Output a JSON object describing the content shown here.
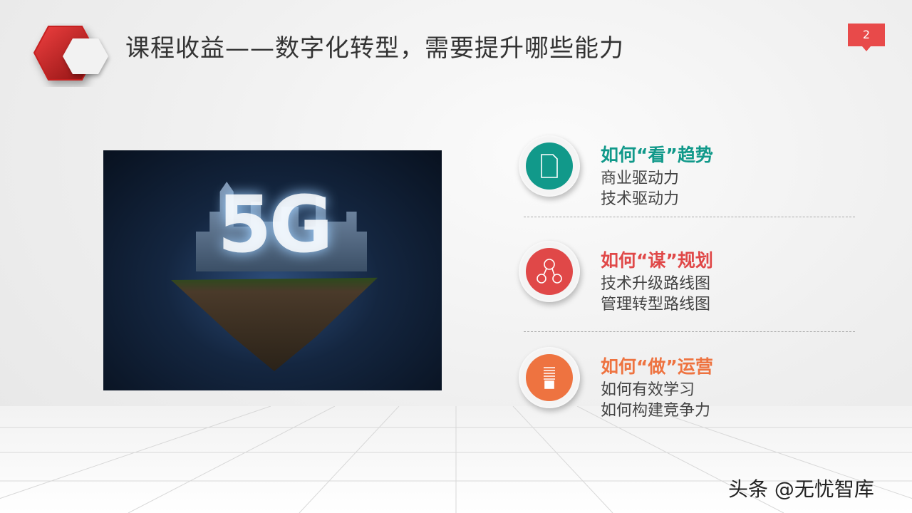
{
  "slide": {
    "title": "课程收益——数字化转型，需要提升哪些能力",
    "page_number": "2"
  },
  "image": {
    "overlay_text": "5G"
  },
  "items": [
    {
      "heading": "如何“看”趋势",
      "color": "#11998a",
      "icon": "document-icon",
      "lines": [
        "商业驱动力",
        "技术驱动力"
      ]
    },
    {
      "heading": "如何“谋”规划",
      "color": "#e04848",
      "icon": "network-nodes-icon",
      "lines": [
        "技术升级路线图",
        "管理转型路线图"
      ]
    },
    {
      "heading": "如何“做”运营",
      "color": "#ee7340",
      "icon": "lightbulb-icon",
      "lines": [
        "如何有效学习",
        "如何构建竞争力"
      ]
    }
  ],
  "watermark": "头条 @无忧智库"
}
